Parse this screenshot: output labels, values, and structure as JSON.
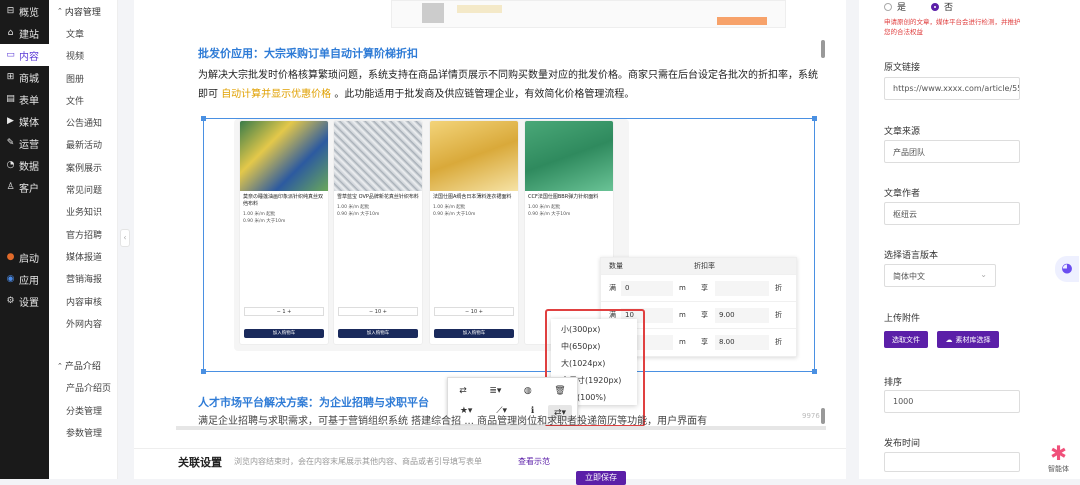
{
  "nav1": {
    "items": [
      {
        "icon": "overview-icon",
        "glyph": "⊟",
        "label": "概览"
      },
      {
        "icon": "build-icon",
        "glyph": "⌂",
        "label": "建站"
      },
      {
        "icon": "content-icon",
        "glyph": "▭",
        "label": "内容"
      },
      {
        "icon": "mall-icon",
        "glyph": "⊞",
        "label": "商城"
      },
      {
        "icon": "form-icon",
        "glyph": "▤",
        "label": "表单"
      },
      {
        "icon": "media-icon",
        "glyph": "▶",
        "label": "媒体"
      },
      {
        "icon": "operation-icon",
        "glyph": "✎",
        "label": "运营"
      },
      {
        "icon": "data-icon",
        "glyph": "◔",
        "label": "数据"
      },
      {
        "icon": "customer-icon",
        "glyph": "♙",
        "label": "客户"
      }
    ],
    "bottom_items": [
      {
        "icon": "launch-icon",
        "glyph": "●",
        "label": "启动"
      },
      {
        "icon": "apps-icon",
        "glyph": "◉",
        "label": "应用"
      },
      {
        "icon": "settings-icon",
        "glyph": "⚙",
        "label": "设置"
      }
    ]
  },
  "nav2": {
    "group1": "内容管理",
    "items1": [
      "文章",
      "视频",
      "图册",
      "文件",
      "公告通知",
      "最新活动",
      "案例展示",
      "常见问题",
      "业务知识",
      "官方招聘",
      "媒体报道",
      "营销海报",
      "内容审核",
      "外网内容"
    ],
    "group2": "产品介绍",
    "items2": [
      "产品介绍页",
      "分类管理",
      "参数管理"
    ]
  },
  "editor": {
    "heading1": "批发价应用：大宗采购订单自动计算阶梯折扣",
    "para1_a": "为解决大宗批发时价格核算繁琐问题，系统支持在商品详情页展示不同购买数量对应的批发价格。商家只需在后台设定各批次的折扣率，系统即可 ",
    "para1_hl": "自动计算并显示优惠价格",
    "para1_b": " 。此功能适用于批发商及供应链管理企业，有效简化价格管理流程。",
    "heading2": "人才市场平台解决方案：为企业招聘与求职平台",
    "para2": "满足企业招聘与求职需求，可基于营销组织系统 搭建综合招 ... 商品管理岗位和求职者投递简历等功能，用户界面有",
    "img_counter": "9976",
    "discount": {
      "col1": "数量",
      "col2": "折扣率",
      "rows": [
        {
          "l": "满",
          "v": "0",
          "u": "m",
          "d": "享",
          "r": "",
          "z": "折"
        },
        {
          "l": "满",
          "v": "10",
          "u": "m",
          "d": "享",
          "r": "9.00",
          "z": "折"
        },
        {
          "l": "",
          "v": "0",
          "u": "m",
          "d": "享",
          "r": "8.00",
          "z": "折"
        }
      ]
    },
    "size_menu": [
      "小(300px)",
      "中(650px)",
      "大(1024px)",
      "全尺寸(1920px)",
      "全宽(100%)"
    ]
  },
  "right": {
    "radio_yes": "是",
    "radio_no": "否",
    "warning": "申请原创的文章，媒体平台会进行检测，并推护您的合法权益",
    "source_url_label": "原文链接",
    "source_url_value": "https://www.xxxx.com/article/556593",
    "source_label": "文章来源",
    "source_value": "产品团队",
    "author_label": "文章作者",
    "author_value": "枢纽云",
    "lang_label": "选择语言版本",
    "lang_value": "简体中文",
    "attach_label": "上传附件",
    "btn_choose": "选取文件",
    "btn_library": "素材库选择",
    "sort_label": "排序",
    "sort_value": "1000",
    "publish_label": "发布时间"
  },
  "bottom": {
    "title": "关联设置",
    "desc": "浏览内容结束时，会在内容末尾展示其他内容、商品或者引导填写表单",
    "link": "查看示范",
    "save": "立即保存"
  },
  "assistant": "智能体",
  "colors": {
    "accent": "#5b1fa8",
    "heading_blue": "#2e7bd6",
    "highlight": "#e0a000",
    "warning": "#e04040",
    "menu_border": "#e04040"
  }
}
